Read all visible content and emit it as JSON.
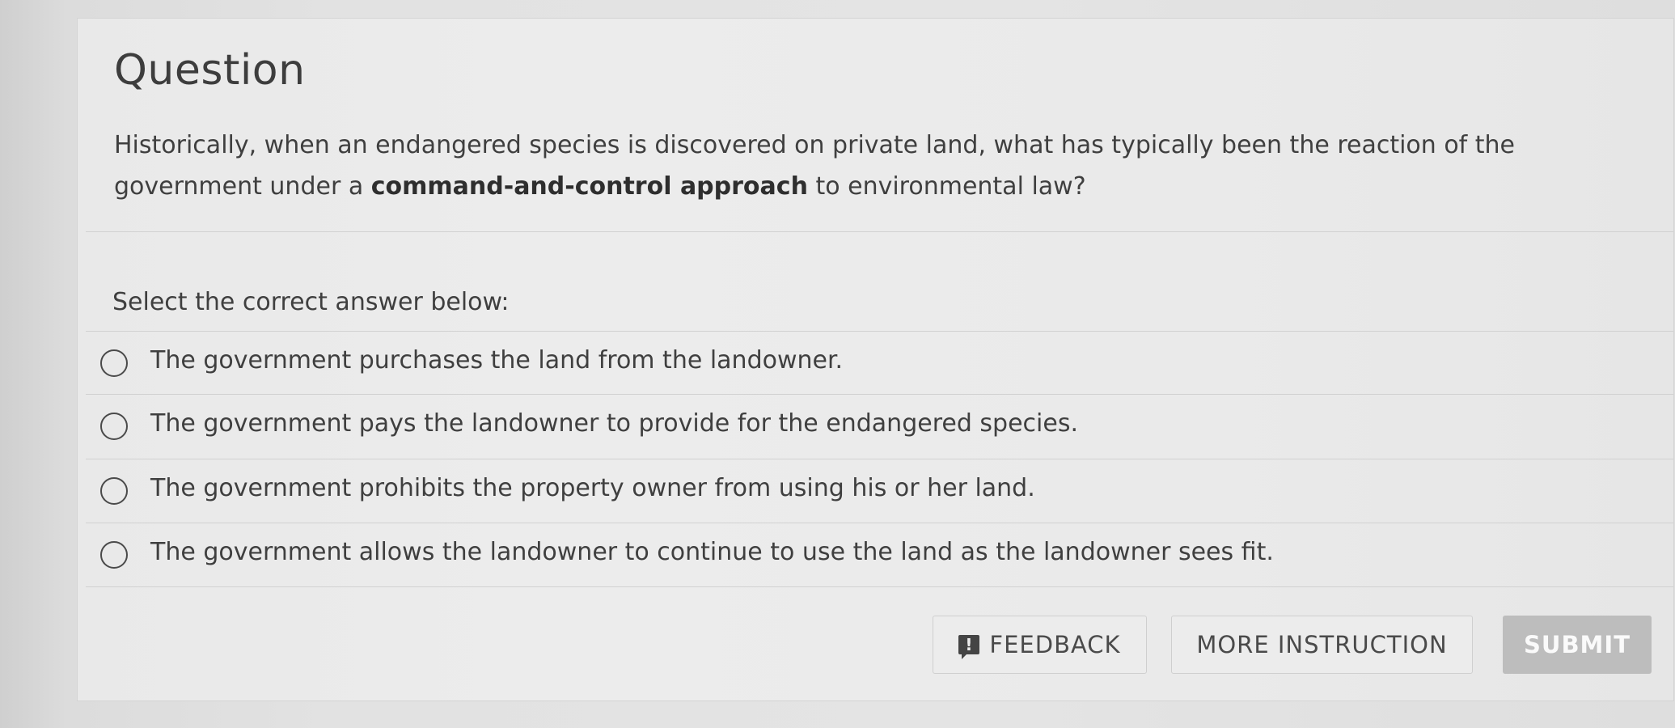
{
  "question": {
    "title": "Question",
    "text_before": "Historically, when an endangered species is discovered on private land, what has typically been the reaction of the government under a ",
    "text_bold": "command-and-control approach",
    "text_after": " to environmental law?"
  },
  "select_label": "Select the correct answer below:",
  "options": [
    {
      "label": "The government purchases the land from the landowner.",
      "selected": false
    },
    {
      "label": "The government pays the landowner to provide for the endangered species.",
      "selected": false
    },
    {
      "label": "The government prohibits the property owner from using his or her land.",
      "selected": false
    },
    {
      "label": "The government allows the landowner to continue to use the land as the landowner sees fit.",
      "selected": false
    }
  ],
  "buttons": {
    "feedback": "FEEDBACK",
    "more_instruction": "MORE INSTRUCTION",
    "submit": "SUBMIT"
  },
  "icons": {
    "feedback": "feedback-exclamation-icon",
    "radio": "radio-unselected-icon"
  },
  "colors": {
    "text": "#3f3f3f",
    "submit_bg": "#bdbdbd",
    "card_bg": "#ececec"
  }
}
